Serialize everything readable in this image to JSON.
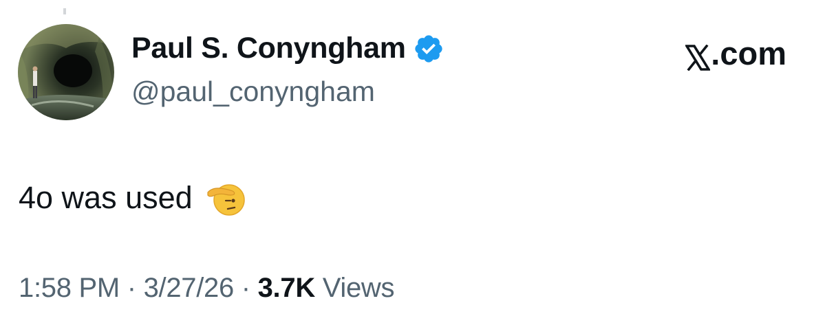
{
  "author": {
    "display_name": "Paul S. Conyngham",
    "handle": "@paul_conyngham",
    "verified": true,
    "verified_color": "#1d9bf0"
  },
  "brand": {
    "label": ".com",
    "logo": "x-logo-icon"
  },
  "tweet": {
    "text": "4o was used",
    "emoji": "saluting-face-icon"
  },
  "meta": {
    "time": "1:58 PM",
    "separator": "·",
    "date": "3/27/26",
    "views_count": "3.7K",
    "views_label": "Views"
  },
  "colors": {
    "text_primary": "#0f1419",
    "text_secondary": "#536471",
    "background": "#ffffff"
  }
}
